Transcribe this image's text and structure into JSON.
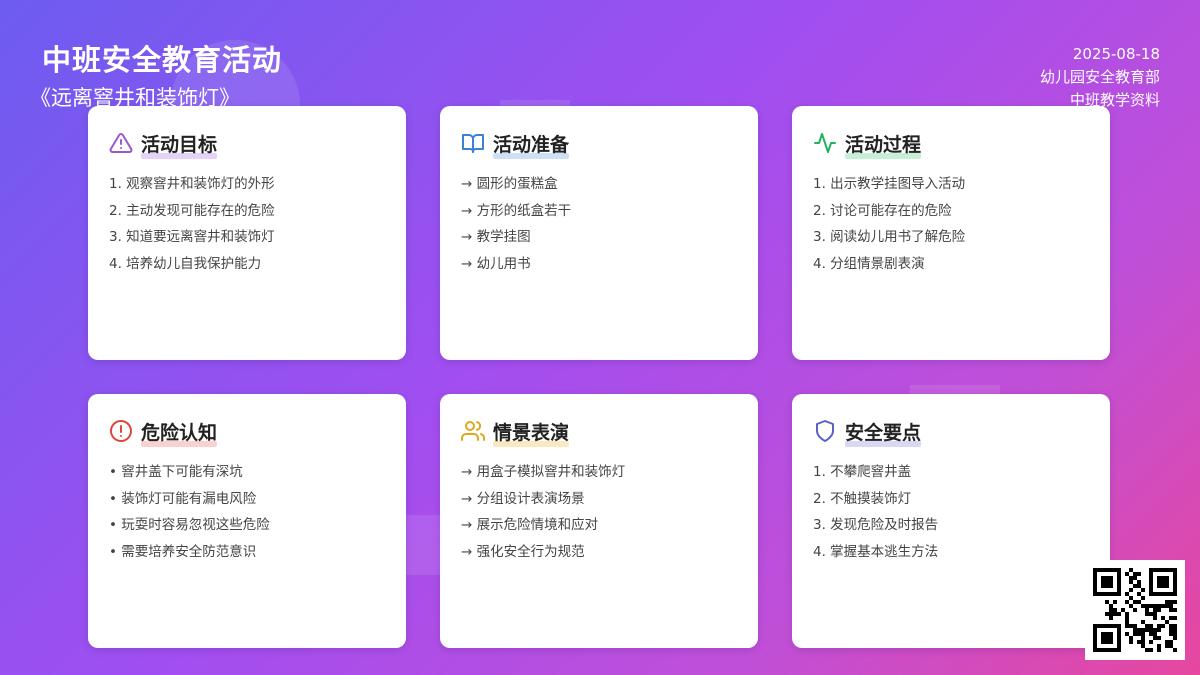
{
  "header": {
    "title": "中班安全教育活动",
    "subtitle": "《远离窨井和装饰灯》",
    "date": "2025-08-18",
    "department": "幼儿园安全教育部",
    "material": "中班教学资料"
  },
  "cards": [
    {
      "title": "活动目标",
      "icon": "warning-triangle-icon",
      "color": "#9b59d0",
      "items": [
        "1. 观察窨井和装饰灯的外形",
        "2. 主动发现可能存在的危险",
        "3. 知道要远离窨井和装饰灯",
        "4. 培养幼儿自我保护能力"
      ]
    },
    {
      "title": "活动准备",
      "icon": "open-book-icon",
      "color": "#3b82d6",
      "items": [
        "→ 圆形的蛋糕盒",
        "→ 方形的纸盒若干",
        "→ 教学挂图",
        "→ 幼儿用书"
      ]
    },
    {
      "title": "活动过程",
      "icon": "activity-pulse-icon",
      "color": "#22b35e",
      "items": [
        "1. 出示教学挂图导入活动",
        "2. 讨论可能存在的危险",
        "3. 阅读幼儿用书了解危险",
        "4. 分组情景剧表演"
      ]
    },
    {
      "title": "危险认知",
      "icon": "alert-circle-icon",
      "color": "#e0443a",
      "items": [
        "• 窨井盖下可能有深坑",
        "• 装饰灯可能有漏电风险",
        "• 玩耍时容易忽视这些危险",
        "• 需要培养安全防范意识"
      ]
    },
    {
      "title": "情景表演",
      "icon": "users-icon",
      "color": "#e0a81e",
      "items": [
        "→ 用盒子模拟窨井和装饰灯",
        "→ 分组设计表演场景",
        "→ 展示危险情境和应对",
        "→ 强化安全行为规范"
      ]
    },
    {
      "title": "安全要点",
      "icon": "shield-icon",
      "color": "#5b5fc7",
      "items": [
        "1. 不攀爬窨井盖",
        "2. 不触摸装饰灯",
        "3. 发现危险及时报告",
        "4. 掌握基本逃生方法"
      ]
    }
  ],
  "qr_code": {
    "icon": "qr-code-icon"
  }
}
